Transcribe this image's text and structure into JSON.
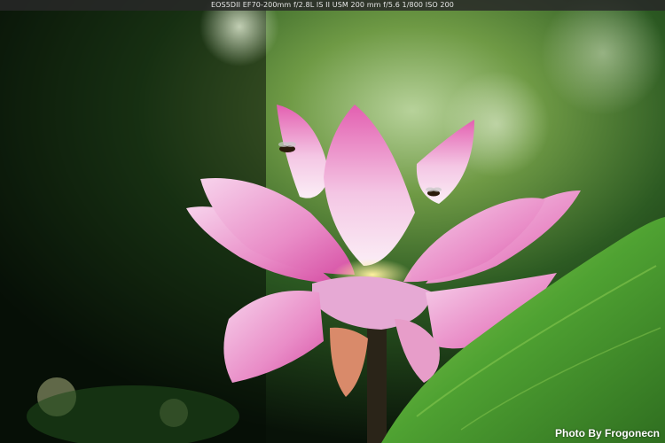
{
  "photo": {
    "subject": "lotus-flower-with-bees",
    "exif_text": "EOS5DII  EF70-200mm f/2.8L IS II USM 200 mm f/5.6  1/800  ISO 200",
    "credit": "Photo By Frogonecn",
    "colors": {
      "background_dark": "#0b1a0c",
      "background_green": "#3f7a2a",
      "petal_pink": "#e46fb6",
      "petal_light": "#f8e6f3",
      "leaf_green": "#5fb83a",
      "stem": "#2a2418"
    }
  }
}
